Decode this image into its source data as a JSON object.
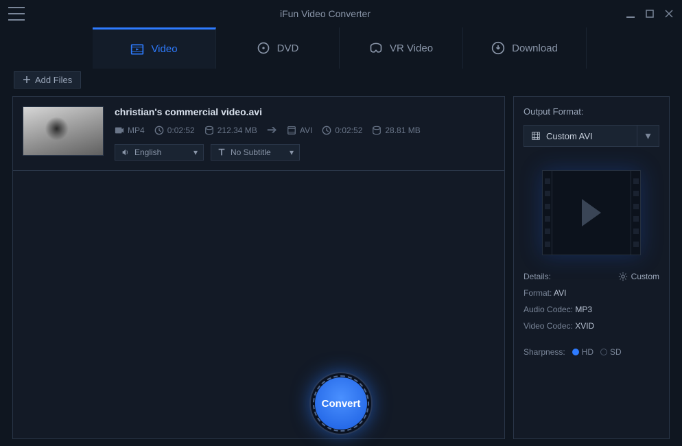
{
  "window": {
    "title": "iFun Video Converter"
  },
  "tabs": [
    {
      "label": "Video"
    },
    {
      "label": "DVD"
    },
    {
      "label": "VR Video"
    },
    {
      "label": "Download"
    }
  ],
  "toolbar": {
    "add_files": "Add Files"
  },
  "file": {
    "name": "christian's commercial video.avi",
    "src_format": "MP4",
    "src_duration": "0:02:52",
    "src_size": "212.34 MB",
    "dst_format": "AVI",
    "dst_duration": "0:02:52",
    "dst_size": "28.81 MB",
    "audio_track": "English",
    "subtitle": "No Subtitle"
  },
  "output": {
    "label": "Output Format:",
    "selected": "Custom AVI",
    "details_label": "Details:",
    "custom_label": "Custom",
    "format_label": "Format:",
    "format_value": "AVI",
    "audio_codec_label": "Audio Codec:",
    "audio_codec_value": "MP3",
    "video_codec_label": "Video Codec:",
    "video_codec_value": "XVID",
    "sharpness_label": "Sharpness:",
    "hd": "HD",
    "sd": "SD"
  },
  "convert": {
    "label": "Convert"
  }
}
